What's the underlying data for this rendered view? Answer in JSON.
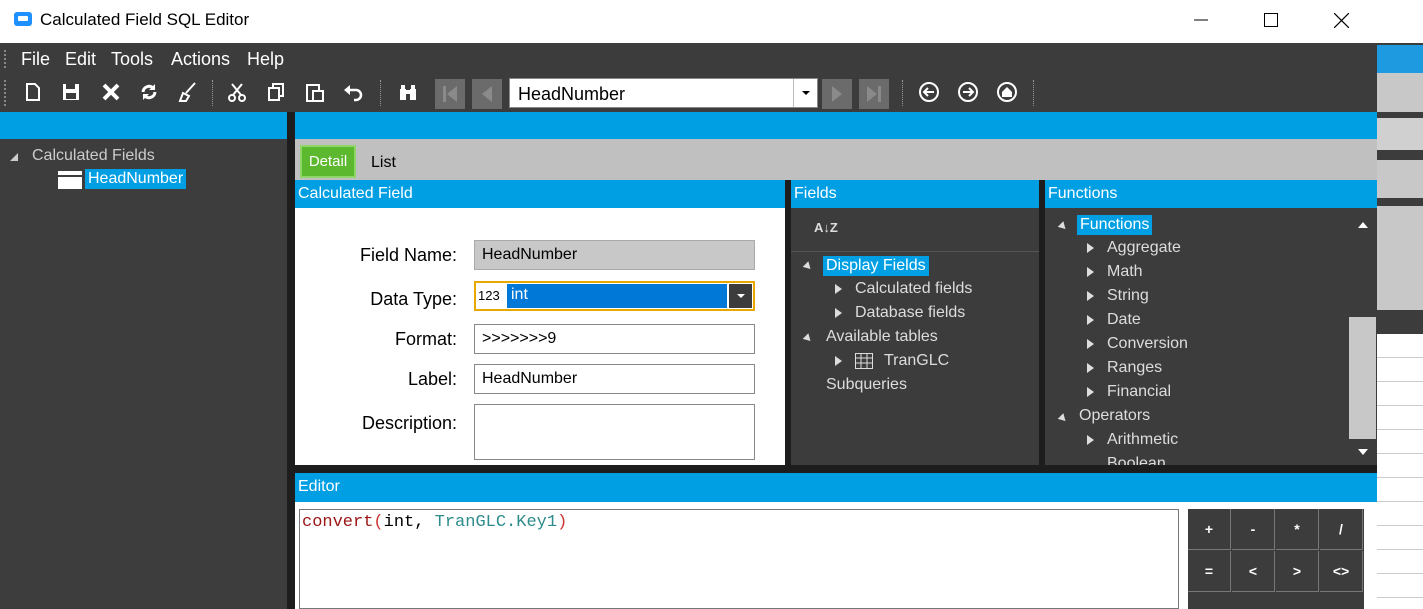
{
  "window": {
    "title": "Calculated Field SQL Editor",
    "minimize": "—",
    "maximize": "☐",
    "close": "✕"
  },
  "menu": [
    "File",
    "Edit",
    "Tools",
    "Actions",
    "Help"
  ],
  "toolbar": {
    "key_field_value": "HeadNumber"
  },
  "tree": {
    "root": "Calculated Fields",
    "child": "HeadNumber"
  },
  "tabs": {
    "detail": "Detail",
    "list": "List"
  },
  "calc": {
    "header": "Calculated Field",
    "field_name_label": "Field Name:",
    "field_name_value": "HeadNumber",
    "data_type_label": "Data Type:",
    "data_type_badge": "123",
    "data_type_value": "int",
    "format_label": "Format:",
    "format_value": ">>>>>>>9",
    "label_label": "Label:",
    "label_value": "HeadNumber",
    "description_label": "Description:",
    "description_value": ""
  },
  "fields": {
    "header": "Fields",
    "sort_glyph": "A↓Z",
    "display_fields": "Display Fields",
    "calculated_fields": "Calculated fields",
    "database_fields": "Database fields",
    "available_tables": "Available tables",
    "tranglc": "TranGLC",
    "subqueries": "Subqueries"
  },
  "functions": {
    "header": "Functions",
    "root": "Functions",
    "items": [
      "Aggregate",
      "Math",
      "String",
      "Date",
      "Conversion",
      "Ranges",
      "Financial"
    ],
    "operators": "Operators",
    "op_items": [
      "Arithmetic",
      "Boolean"
    ]
  },
  "editor": {
    "header": "Editor",
    "code_fn": "convert",
    "code_open": "(",
    "code_type": "int, ",
    "code_ref": "TranGLC.Key1",
    "code_close": ")"
  },
  "operators": {
    "row1": [
      "+",
      "-",
      "*",
      "/"
    ],
    "row2": [
      "=",
      "<",
      ">",
      "<>"
    ]
  },
  "colors": {
    "accent": "#009fe3",
    "dark_panel": "#3c3c3c",
    "detail_tab": "#5cb82e",
    "selected_dropdown": "#0078d7"
  }
}
